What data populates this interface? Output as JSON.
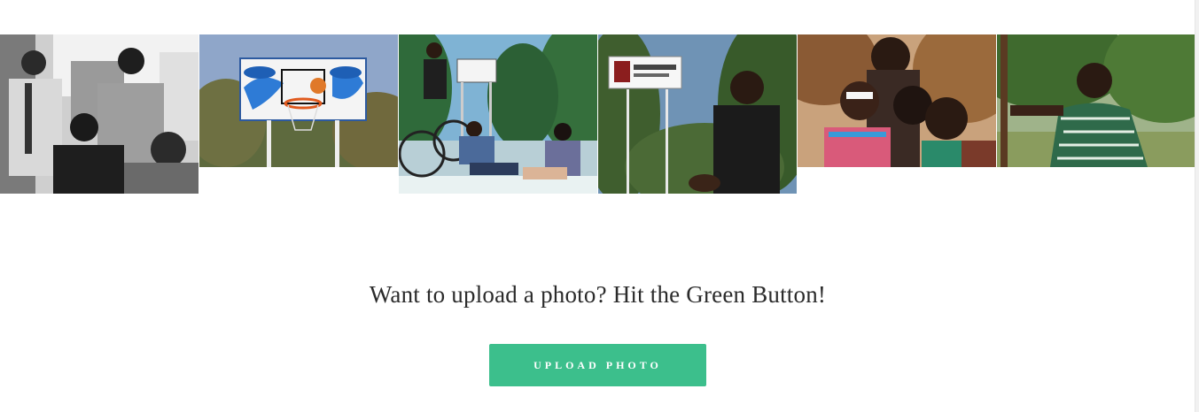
{
  "gallery": {
    "photos": [
      {
        "name": "Group of students in black and white"
      },
      {
        "name": "Basketball hoop with ball"
      },
      {
        "name": "Students at Strathmore University sign with bicycle"
      },
      {
        "name": "Student in front of Strathmore University sign"
      },
      {
        "name": "Friends posing together"
      },
      {
        "name": "Student in patterned shirt outdoors"
      }
    ]
  },
  "cta": {
    "prompt": "Want to upload a photo? Hit the Green Button!",
    "button_label": "UPLOAD PHOTO"
  },
  "colors": {
    "button_bg": "#3cbf8c",
    "text": "#2b2b2b",
    "background": "#ffffff"
  }
}
